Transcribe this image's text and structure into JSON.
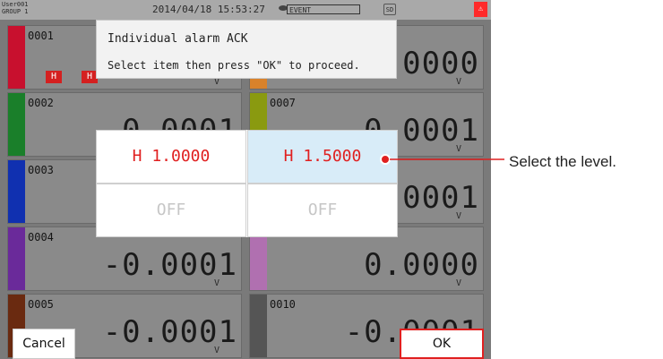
{
  "statusbar": {
    "user": "User001",
    "group": "GROUP 1",
    "datetime": "2014/04/18 15:53:27",
    "event_label": "EVENT",
    "sd_label": "SD",
    "alarm_icon": "alarm-icon"
  },
  "tiles": [
    {
      "ch": "0001",
      "value": "",
      "unit": "V",
      "color": "#c8102e",
      "badges": [
        "H",
        "H"
      ]
    },
    {
      "ch": "0002",
      "value": "-0.0001",
      "unit": "V",
      "color": "#1a7f2a"
    },
    {
      "ch": "0003",
      "value": "",
      "unit": "",
      "color": "#1030b0"
    },
    {
      "ch": "0004",
      "value": "-0.0001",
      "unit": "V",
      "color": "#6a2a9a"
    },
    {
      "ch": "0005",
      "value": "-0.0001",
      "unit": "V",
      "color": "#6a2a10"
    },
    {
      "ch": "",
      "value": ".0000",
      "unit": "V",
      "color": "#d9822b"
    },
    {
      "ch": "0007",
      "value": "-0.0001",
      "unit": "V",
      "color": "#8a9a10"
    },
    {
      "ch": "",
      "value": ".0001",
      "unit": "V",
      "color": "#2a8ab0"
    },
    {
      "ch": "",
      "value": "0.0000",
      "unit": "V",
      "color": "#b070b0"
    },
    {
      "ch": "0010",
      "value": "-0.0001",
      "unit": "",
      "color": "#555555"
    }
  ],
  "dialog": {
    "title": "Individual alarm ACK",
    "message": "Select item then press \"OK\" to proceed."
  },
  "levels": {
    "selected_index": 1,
    "items": [
      "H 1.0000",
      "H 1.5000",
      "OFF",
      "OFF"
    ]
  },
  "buttons": {
    "cancel": "Cancel",
    "ok": "OK"
  },
  "annotation": "Select the level.",
  "colors": {
    "alarm": "#e02020",
    "selected_bg": "#d8ecf8",
    "callout": "#e02020"
  }
}
